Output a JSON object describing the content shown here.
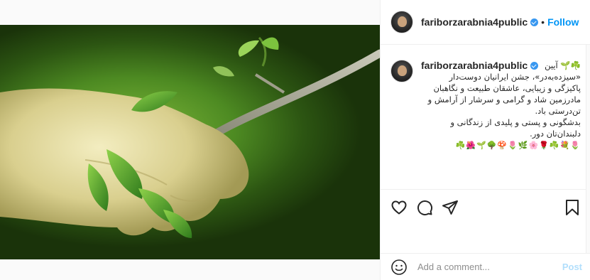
{
  "post": {
    "image_description_icon": "hand-with-branch-photo"
  },
  "header": {
    "username": "fariborzarabnia4public",
    "dot": "•",
    "follow_label": "Follow"
  },
  "caption": {
    "username": "fariborzarabnia4public",
    "first_line_tail": "آیین 🌱☘️",
    "text": "«سیزده‌به‌در»، جشن ایرانیان دوست‌دار پاکیزگی و زیبایی، عاشقان طبیعت و نگاهبان مادرزمین شاد و گرامی و سرشار از آرامش و تن‌درستی باد.\nبدشگونی و پستی و پلیدی از زندگانی و دلبندان‌تان دور.",
    "emojis": "🌷💐☘️🌹🌸🌿🌷🍄🌳🌱🌺☘️"
  },
  "actions": {
    "like_icon": "heart-icon",
    "comment_icon": "comment-icon",
    "share_icon": "share-icon",
    "save_icon": "bookmark-icon"
  },
  "comment_box": {
    "emoji_icon": "smiley-icon",
    "placeholder": "Add a comment...",
    "post_label": "Post"
  },
  "colors": {
    "link_blue": "#0095f6",
    "post_disabled": "#b2dffc",
    "verified": "#3897f0"
  }
}
